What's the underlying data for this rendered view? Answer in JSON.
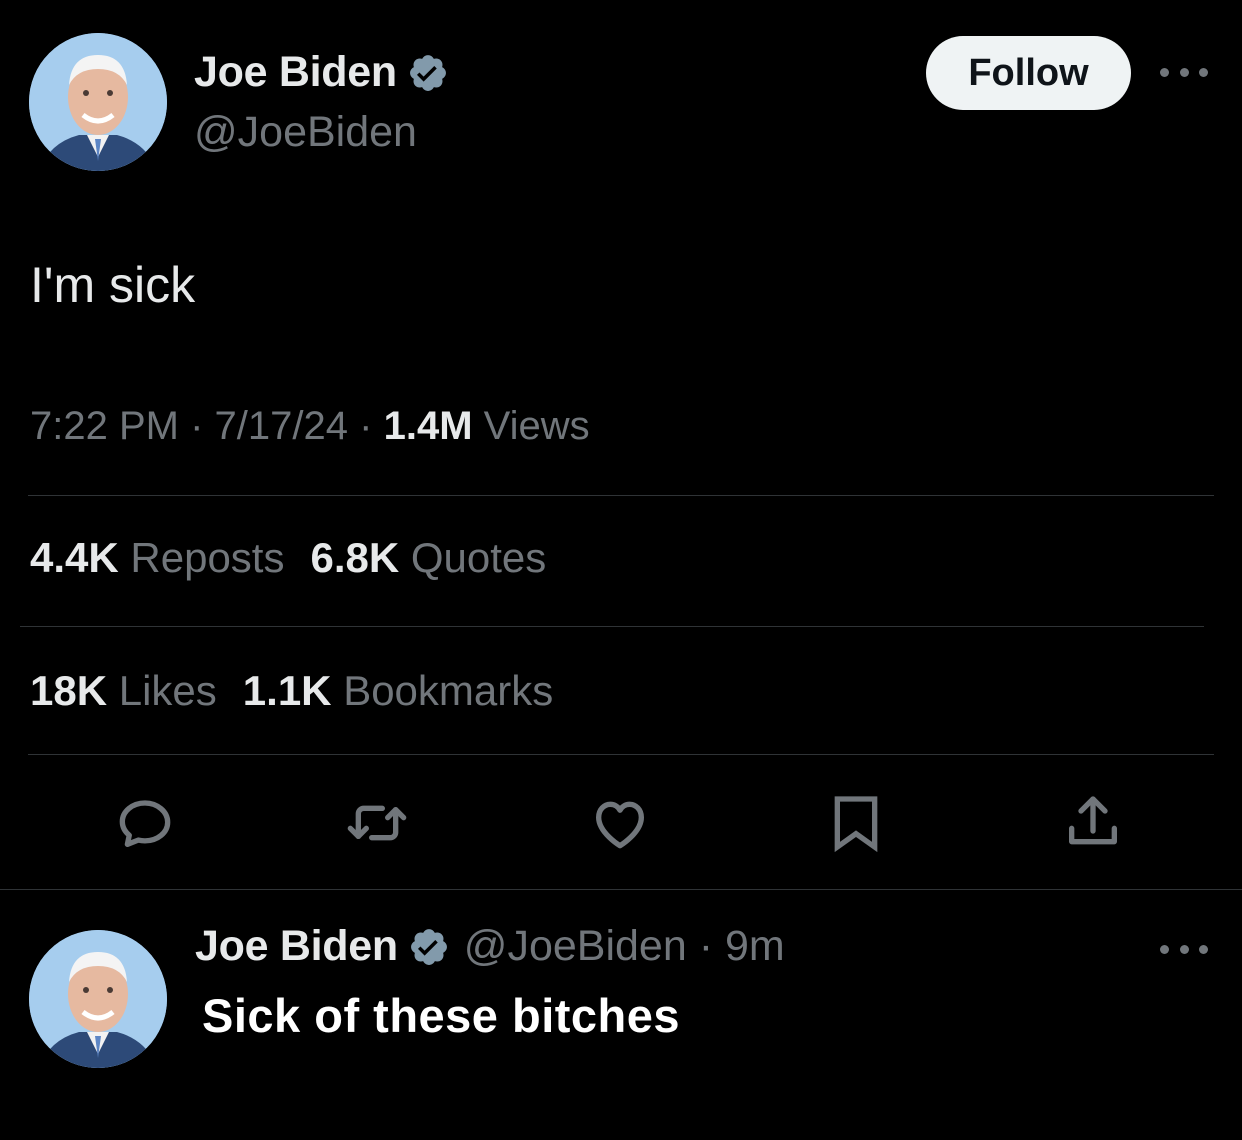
{
  "tweet": {
    "author_name": "Joe Biden",
    "author_handle": "@JoeBiden",
    "follow_label": "Follow",
    "text": "I'm sick",
    "time": "7:22 PM",
    "date": "7/17/24",
    "views_count": "1.4M",
    "views_label": "Views",
    "separator": "·",
    "reposts_count": "4.4K",
    "reposts_label": "Reposts",
    "quotes_count": "6.8K",
    "quotes_label": "Quotes",
    "likes_count": "18K",
    "likes_label": "Likes",
    "bookmarks_count": "1.1K",
    "bookmarks_label": "Bookmarks"
  },
  "actions": [
    "reply-icon",
    "repost-icon",
    "like-icon",
    "bookmark-icon",
    "share-icon"
  ],
  "reply": {
    "author_name": "Joe Biden",
    "author_handle": "@JoeBiden",
    "age": "9m",
    "separator": "·",
    "text": "Sick of these bitches"
  },
  "colors": {
    "background": "#000000",
    "text_primary": "#e7e9ea",
    "text_secondary": "#71767b",
    "divider": "#2f3336",
    "verified": "#829aab",
    "follow_bg": "#eff3f4"
  }
}
